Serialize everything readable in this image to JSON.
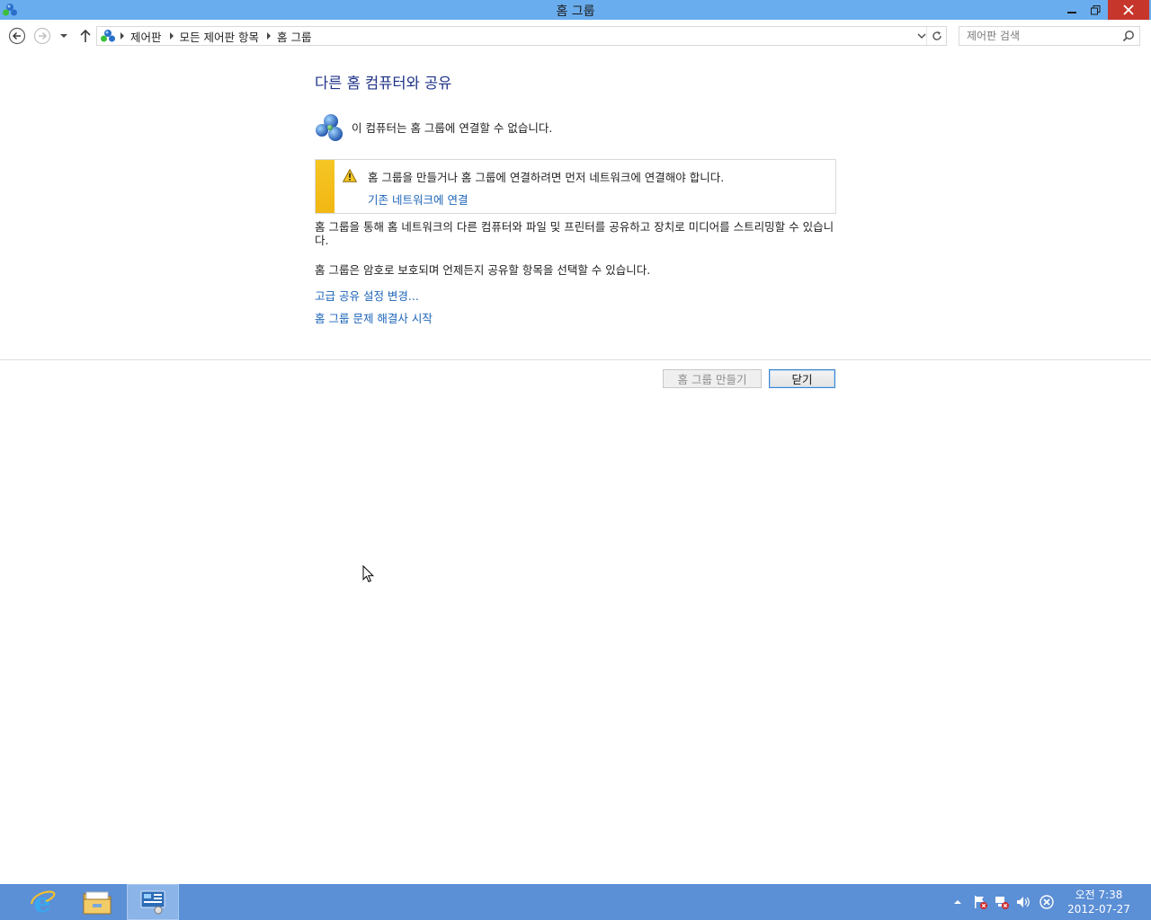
{
  "window": {
    "title": "홈 그룹"
  },
  "address_bar": {
    "breadcrumbs": [
      "제어판",
      "모든 제어판 항목",
      "홈 그룹"
    ]
  },
  "search": {
    "placeholder": "제어판 검색"
  },
  "content": {
    "heading": "다른 홈 컴퓨터와 공유",
    "status_text": "이 컴퓨터는 홈 그룹에 연결할 수 없습니다.",
    "warning": {
      "text": "홈 그룹을 만들거나 홈 그룹에 연결하려면 먼저 네트워크에 연결해야 합니다.",
      "link": "기존 네트워크에 연결"
    },
    "description1": "홈 그룹을 통해 홈 네트워크의 다른 컴퓨터와 파일 및 프린터를 공유하고 장치로 미디어를 스트리밍할 수 있습니다.",
    "description2": "홈 그룹은 암호로 보호되며 언제든지 공유할 항목을 선택할 수 있습니다.",
    "links": {
      "advanced_sharing": "고급 공유 설정 변경...",
      "troubleshooter": "홈 그룹 문제 해결사 시작"
    }
  },
  "buttons": {
    "create": "홈 그룹 만들기",
    "close": "닫기"
  },
  "taskbar": {
    "clock_time": "오전 7:38",
    "clock_date": "2012-07-27"
  },
  "colors": {
    "titlebar": "#6aadee",
    "taskbar": "#5b8fd6",
    "heading": "#1e3287",
    "link": "#1c64b8",
    "warning_strip": "#f5c625",
    "close_button": "#c7362b"
  }
}
